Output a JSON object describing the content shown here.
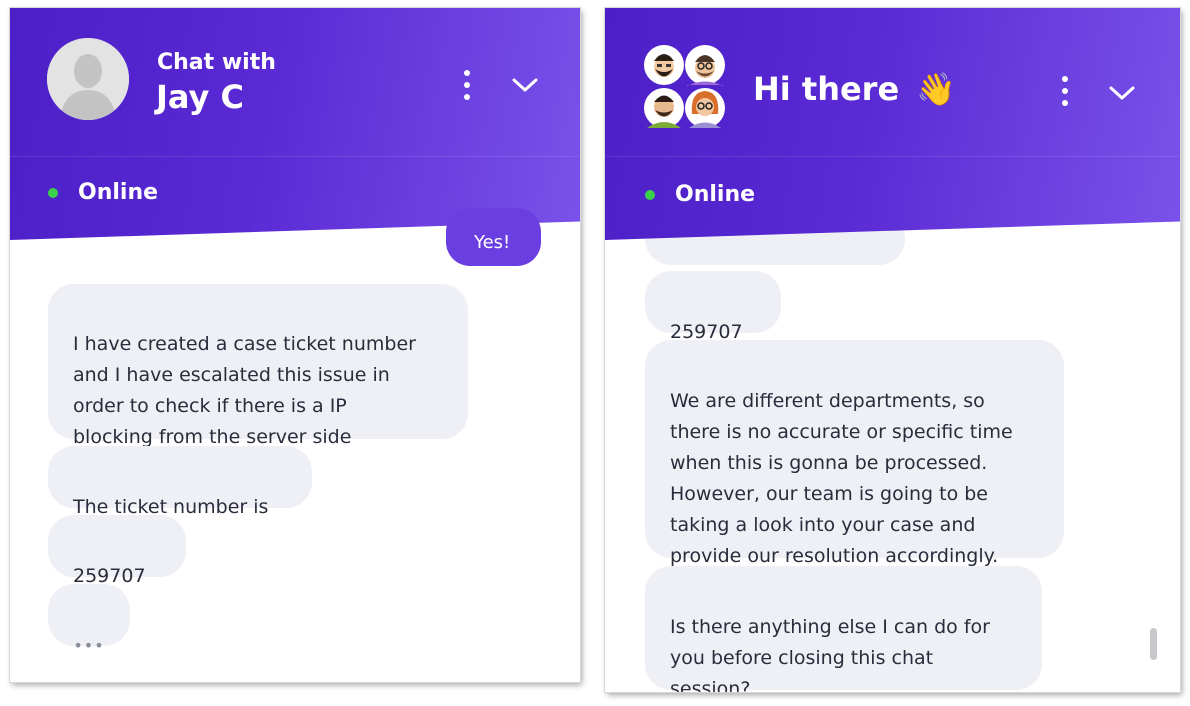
{
  "left_chat": {
    "header": {
      "title_prefix": "Chat with",
      "agent_name": "Jay C",
      "status": "Online"
    },
    "user_reply_partial": "Yes!",
    "messages": [
      "I have created a case ticket number\nand I have escalated this issue in\norder to check if there is a IP\nblocking from the server side",
      "The ticket number is",
      "259707"
    ],
    "typing_indicator": "•••"
  },
  "right_chat": {
    "header": {
      "greeting": "Hi there",
      "greeting_emoji": "👋",
      "status": "Online"
    },
    "messages": [
      "259707",
      "We are different departments, so\nthere is no accurate or specific time\nwhen this is gonna be processed.\nHowever, our team is going to be\ntaking a look into your case and\nprovide our resolution accordingly.",
      "Is there anything else I can do for\nyou before closing this chat\nsession?"
    ]
  },
  "colors": {
    "header_start": "#4c1fc7",
    "header_end": "#7a52ea",
    "online": "#3bd14a",
    "bubble_bg": "#eff0f6",
    "user_bubble_bg": "#6a3ee0"
  },
  "icons": [
    "avatar-placeholder-icon",
    "team-avatars-icon",
    "more-vert-icon",
    "chevron-down-icon",
    "waving-hand-icon"
  ]
}
